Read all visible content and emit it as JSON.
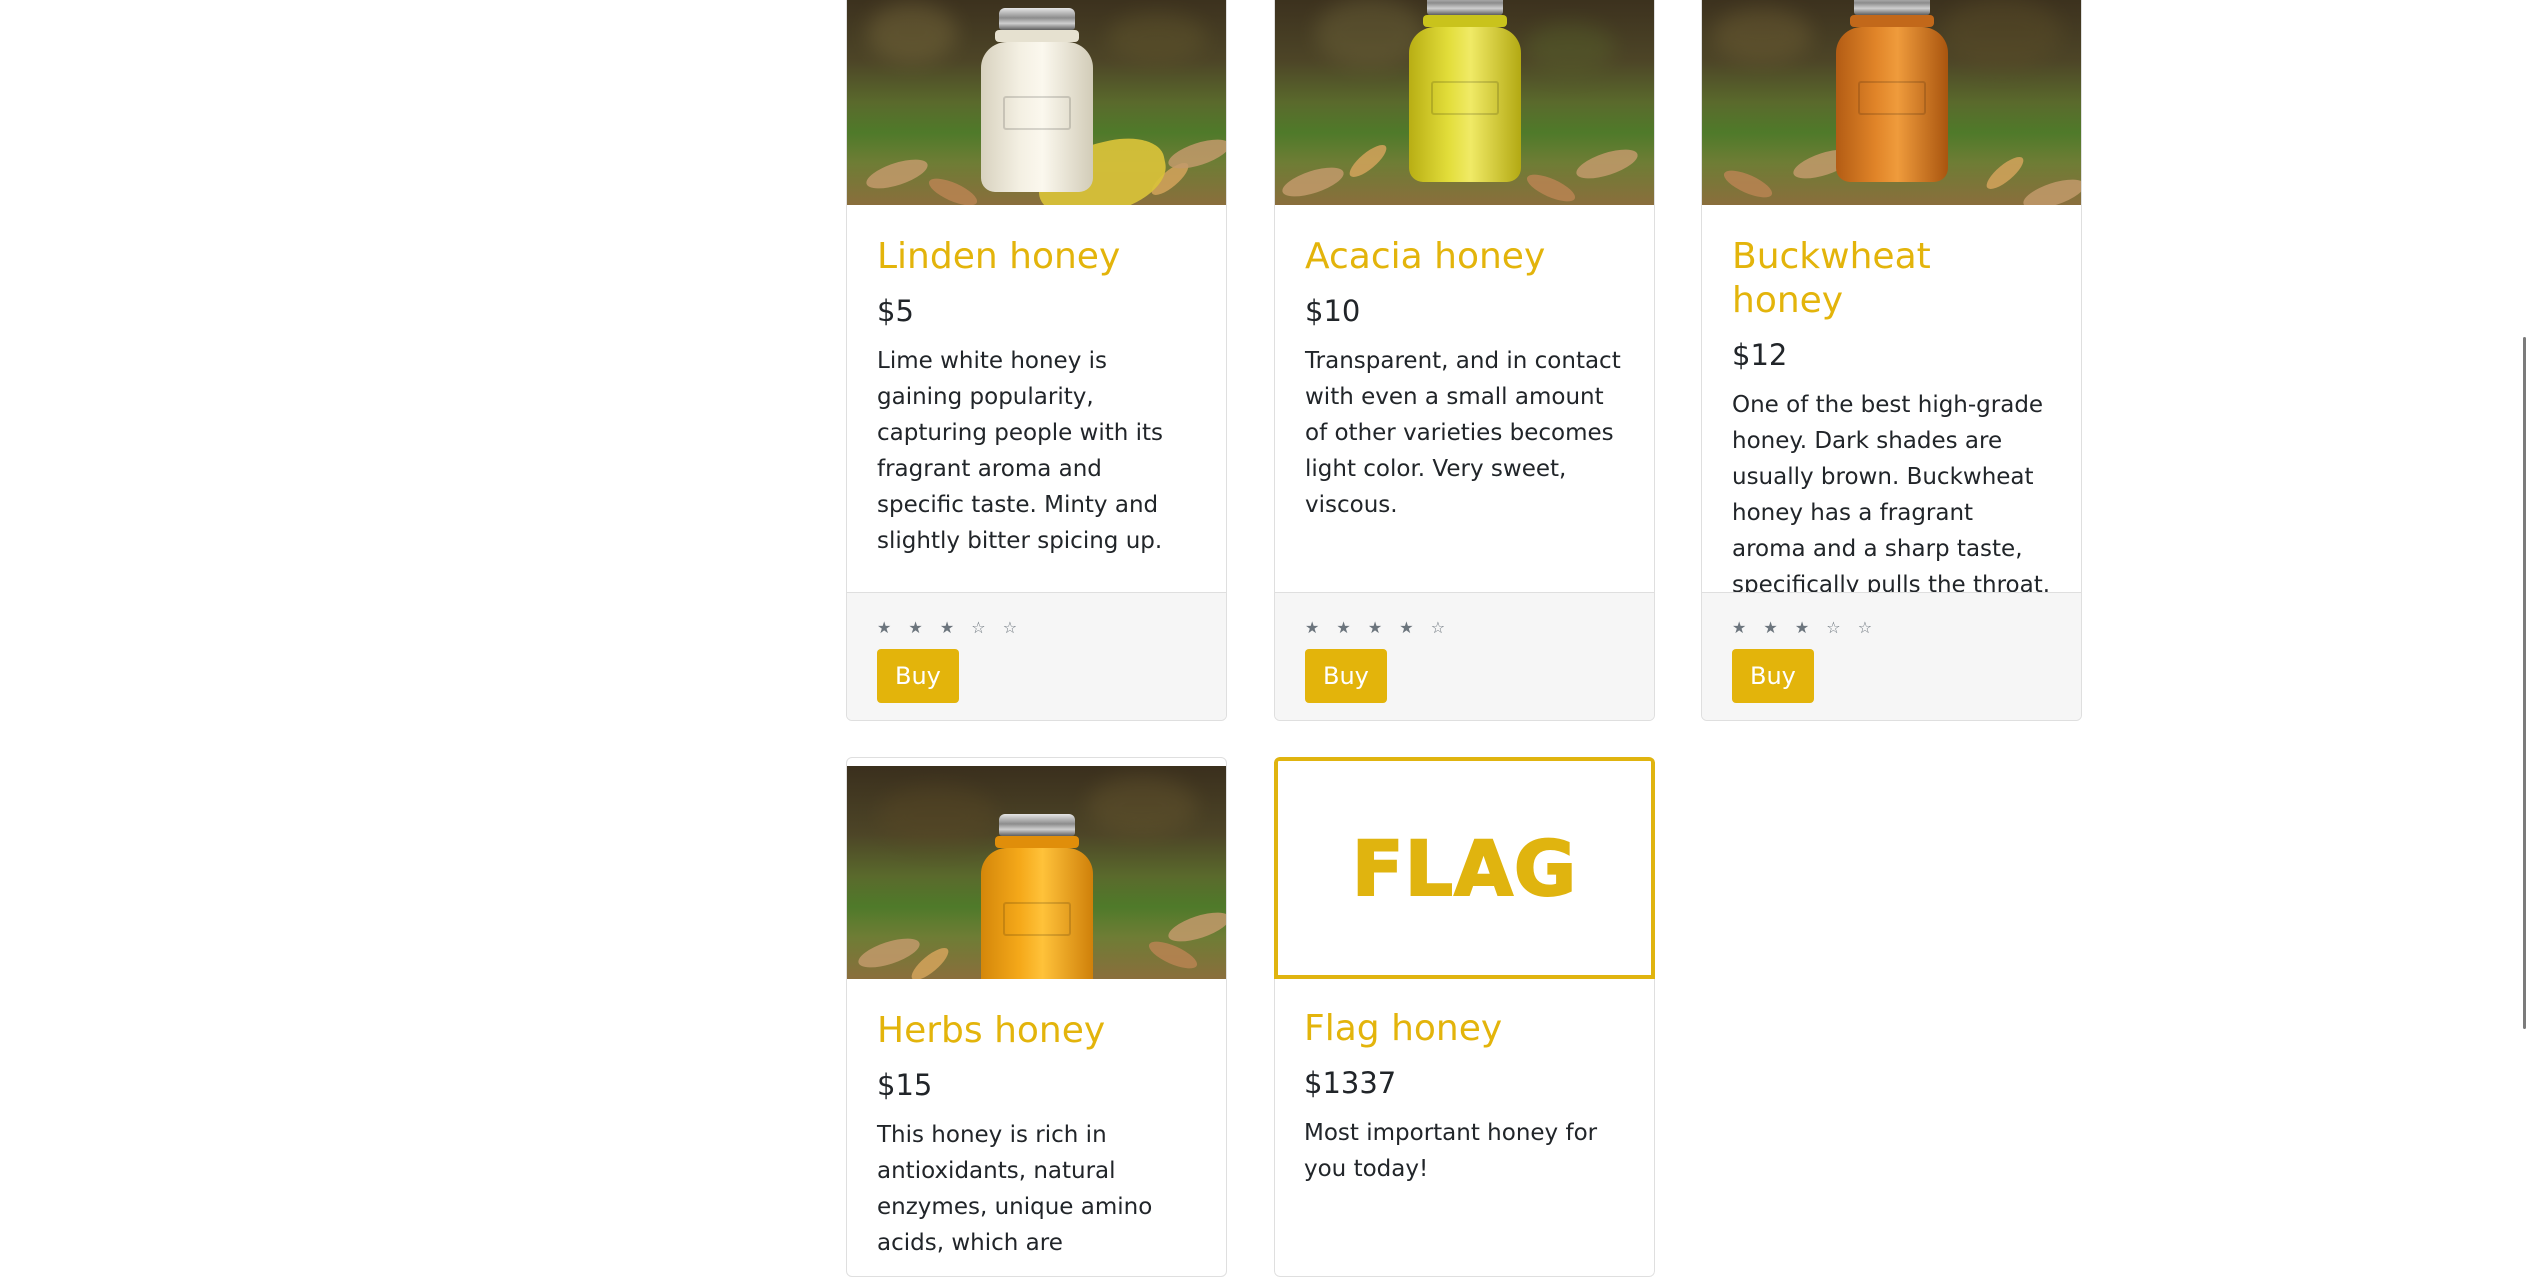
{
  "products": [
    {
      "name": "Linden honey",
      "price": "$5",
      "description": "Lime white honey is gaining popularity, capturing people with its fragrant aroma and specific taste. Minty and slightly bitter spicing up.",
      "stars": "★ ★ ★ ☆ ☆",
      "rating": 3,
      "buy_label": "Buy",
      "jar_color": "#ece7d7",
      "image": "honey-jar-photo"
    },
    {
      "name": "Acacia honey",
      "price": "$10",
      "description": "Transparent, and in contact with even a small amount of other varieties becomes light color. Very sweet, viscous.",
      "stars": "★ ★ ★ ★ ☆",
      "rating": 4,
      "buy_label": "Buy",
      "jar_color": "#d6d21f",
      "image": "honey-jar-photo"
    },
    {
      "name": "Buckwheat honey",
      "price": "$12",
      "description": "One of the best high-grade honey. Dark shades are usually brown. Buckwheat honey has a fragrant aroma and a sharp taste, specifically pulls the throat.",
      "stars": "★ ★ ★ ☆ ☆",
      "rating": 3,
      "buy_label": "Buy",
      "jar_color": "#d8741e",
      "image": "honey-jar-photo"
    },
    {
      "name": "Herbs honey",
      "price": "$15",
      "description": "This honey is rich in antioxidants, natural enzymes, unique amino acids, which are",
      "jar_color": "#f2a50e",
      "image": "honey-jar-photo"
    },
    {
      "name": "Flag honey",
      "price": "$1337",
      "description": "Most important honey for you today!",
      "flag_image_text": "FLAG",
      "image": "flag-logo"
    }
  ],
  "colors": {
    "accent": "#e3b40b",
    "footer_bg": "#f6f6f6",
    "border": "#dfdfdf",
    "text": "#212529",
    "stars": "#6c757d"
  }
}
